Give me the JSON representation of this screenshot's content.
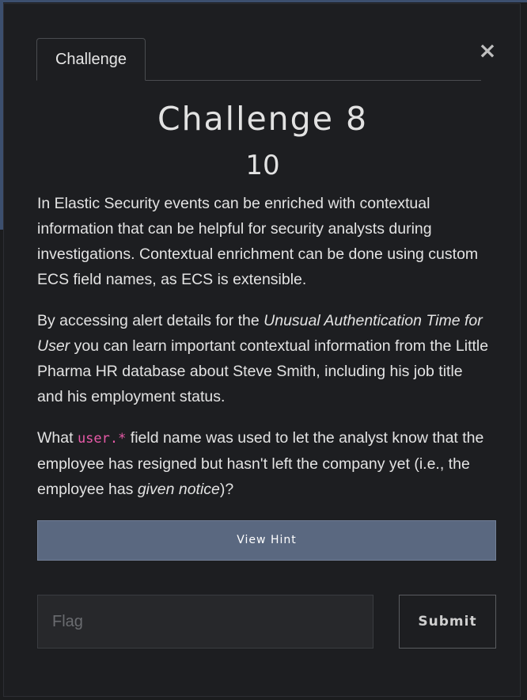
{
  "tabs": [
    {
      "label": "Challenge"
    }
  ],
  "close_icon": "close-icon",
  "challenge": {
    "title": "Challenge 8",
    "points": "10",
    "paragraph1": "In Elastic Security events can be enriched with contextual information that can be helpful for security analysts during investigations. Contextual enrichment can be done using custom ECS field names, as ECS is extensible.",
    "paragraph2_pre": "By accessing alert details for the ",
    "paragraph2_em": "Unusual Authentication Time for User",
    "paragraph2_post": " you can learn important contextual information from the Little Pharma HR database about Steve Smith, including his job title and his employment status.",
    "paragraph3_pre": "What ",
    "paragraph3_code": "user.*",
    "paragraph3_mid": " field name was used to let the analyst know that the employee has resigned but hasn't left the company yet (i.e., the employee has ",
    "paragraph3_em": "given notice",
    "paragraph3_post": ")?"
  },
  "hint_button": {
    "label": "View Hint"
  },
  "flag_input": {
    "placeholder": "Flag",
    "value": ""
  },
  "submit_button": {
    "label": "Submit"
  },
  "colors": {
    "background": "#1d1e21",
    "accent": "#5a6880",
    "code": "#e85aa8"
  }
}
